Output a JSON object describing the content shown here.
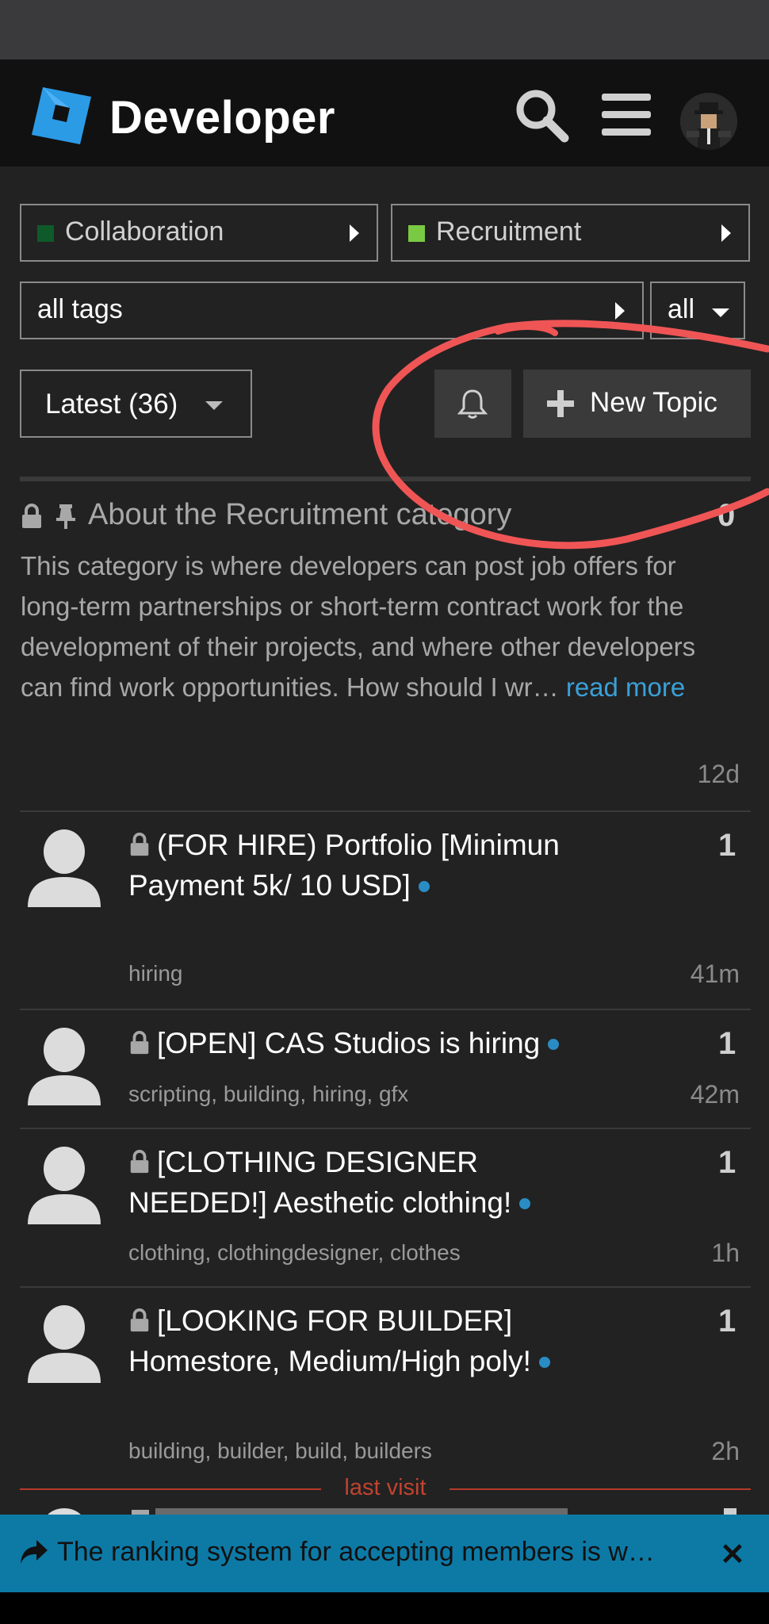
{
  "header": {
    "brand": "Developer",
    "search_icon": "search-icon",
    "menu_icon": "hamburger-menu-icon"
  },
  "breadcrumbs": [
    {
      "label": "Collaboration",
      "color": "#0e5a2a"
    },
    {
      "label": "Recruitment",
      "color": "#7ac943"
    }
  ],
  "filters": {
    "tags_label": "all tags",
    "all_label": "all"
  },
  "controls": {
    "latest_label": "Latest (36)",
    "new_topic_label": "New Topic",
    "bell_icon": "bell-icon"
  },
  "pinned": {
    "title": "About the Recruitment category",
    "count": "0",
    "excerpt": "This category is where developers can post job offers for long-term partnerships or short-term contract work for the development of their projects, and where other developers can find work opportunities. How should I wr…",
    "read_more": "read more",
    "age": "12d"
  },
  "topics": [
    {
      "title": "(FOR HIRE) Portfolio [Minimun Payment 5k/ 10 USD]",
      "tags": "hiring",
      "count": "1",
      "age": "41m"
    },
    {
      "title": "[OPEN] CAS Studios is hiring",
      "tags": "scripting, building, hiring, gfx",
      "count": "1",
      "age": "42m"
    },
    {
      "title": "[CLOTHING DESIGNER NEEDED!] Aesthetic clothing!",
      "tags": "clothing, clothingdesigner, clothes",
      "count": "1",
      "age": "1h"
    },
    {
      "title": "[LOOKING FOR BUILDER] Homestore, Medium/High poly!",
      "tags": "building, builder, build, builders",
      "count": "1",
      "age": "2h"
    }
  ],
  "last_visit_label": "last visit",
  "banner": {
    "text": "The ranking system for accepting members is w…",
    "close": "✕"
  },
  "colors": {
    "accent_blue": "#0d7aa6",
    "unread_dot": "#2a8cc4",
    "annotation_red": "#f05555"
  }
}
